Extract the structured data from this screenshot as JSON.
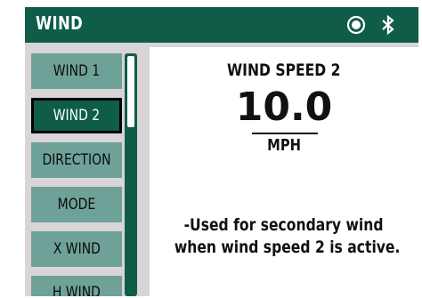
{
  "header": {
    "title": "WIND",
    "icons": [
      "record-icon",
      "bluetooth-icon"
    ],
    "background_color": "#0f5d48"
  },
  "sidebar": {
    "items": [
      {
        "label": "WIND 1",
        "selected": false
      },
      {
        "label": "WIND 2",
        "selected": true
      },
      {
        "label": "DIRECTION",
        "selected": false
      },
      {
        "label": "MODE",
        "selected": false
      },
      {
        "label": "X WIND",
        "selected": false
      },
      {
        "label": "H WIND",
        "selected": false
      }
    ],
    "button_color": "#6ea298",
    "selected_color": "#0f5d48"
  },
  "detail": {
    "title": "WIND SPEED 2",
    "value": "10.0",
    "unit": "MPH",
    "description_line1": "-Used for secondary wind",
    "description_line2": "when wind speed 2 is active."
  }
}
